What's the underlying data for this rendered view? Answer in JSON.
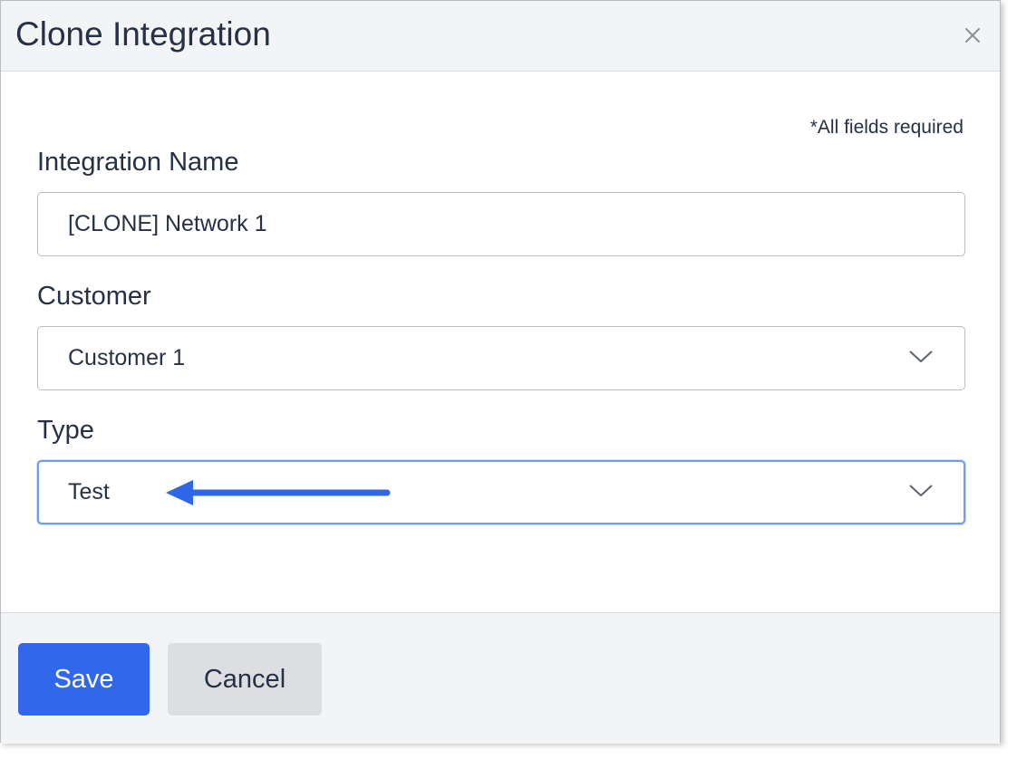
{
  "dialog": {
    "title": "Clone Integration",
    "required_note": "*All fields required"
  },
  "fields": {
    "integration_name": {
      "label": "Integration Name",
      "value": "[CLONE] Network 1"
    },
    "customer": {
      "label": "Customer",
      "selected": "Customer 1"
    },
    "type": {
      "label": "Type",
      "selected": "Test"
    }
  },
  "footer": {
    "save_label": "Save",
    "cancel_label": "Cancel"
  },
  "icons": {
    "close": "close-icon",
    "chevron": "chevron-down-icon",
    "annotation": "arrow-left-icon"
  },
  "colors": {
    "primary": "#3168eb",
    "text": "#263145",
    "annotation_arrow": "#2f67e8",
    "focus_ring": "#6d9cf2"
  }
}
